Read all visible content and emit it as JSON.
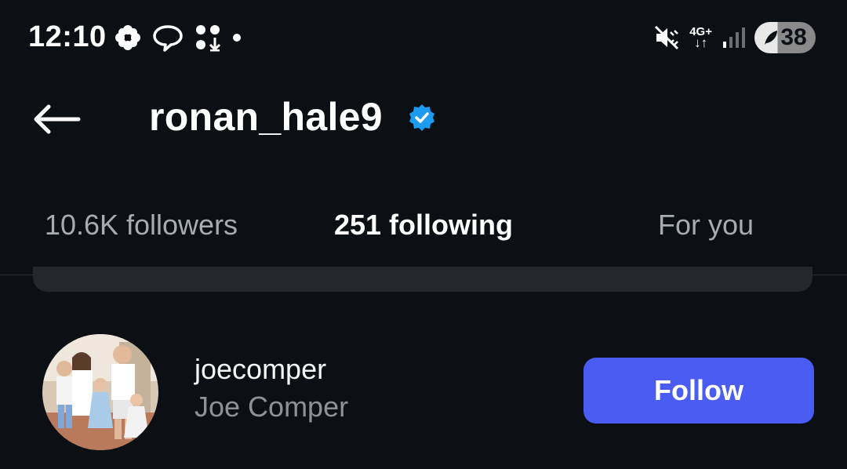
{
  "status_bar": {
    "time": "12:10",
    "left_icons": [
      "flower-icon",
      "chat-bubble-icon",
      "download-dots-icon",
      "dot-icon"
    ],
    "right_icons": [
      "vibrate-mute-icon",
      "network-4g-icon",
      "signal-icon"
    ],
    "network_label": "4G+",
    "battery_level": "38"
  },
  "header": {
    "profile_name": "ronan_hale9",
    "verified": true,
    "accent_color": "#1d9bf0"
  },
  "tabs": [
    {
      "label": "10.6K followers",
      "active": false
    },
    {
      "label": "251 following",
      "active": true
    },
    {
      "label": "For you",
      "active": false
    }
  ],
  "list": {
    "users": [
      {
        "username": "joecomper",
        "full_name": "Joe Comper",
        "action_label": "Follow"
      }
    ]
  },
  "colors": {
    "background": "#0c1014",
    "follow_button": "#4a5cf2"
  }
}
